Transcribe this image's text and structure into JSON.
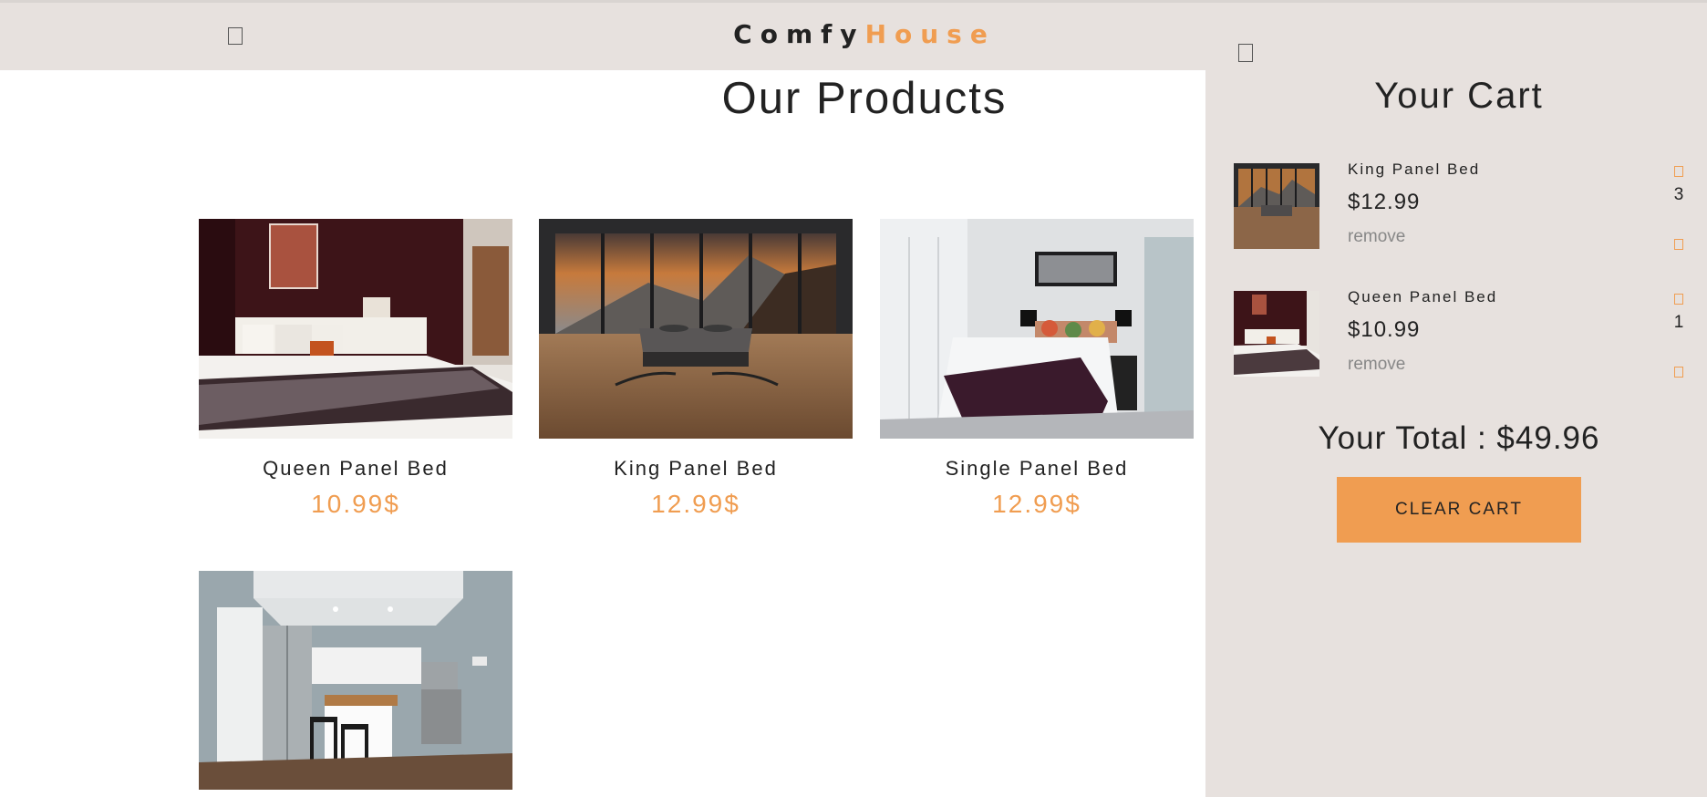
{
  "navbar": {
    "menu_icon": "menu-icon",
    "logo_part1": "Comfy",
    "logo_part2": "House",
    "accent_color": "#f09d51",
    "bar_color": "#e7e1de"
  },
  "products": {
    "title": "Our Products",
    "items": [
      {
        "name": "Queen Panel Bed",
        "price": "10.99$",
        "image": "bedroom-queen-bed-photo"
      },
      {
        "name": "King Panel Bed",
        "price": "12.99$",
        "image": "mountain-view-bed-photo"
      },
      {
        "name": "Single Panel Bed",
        "price": "12.99$",
        "image": "white-bedroom-bed-photo"
      },
      {
        "name": "",
        "price": "",
        "image": "kitchen-photo"
      }
    ]
  },
  "cart": {
    "close_icon": "close-cart-icon",
    "title": "Your Cart",
    "items": [
      {
        "name": "King Panel Bed",
        "price": "$12.99",
        "remove": "remove",
        "qty": "3",
        "image": "mountain-view-bed-thumb"
      },
      {
        "name": "Queen Panel Bed",
        "price": "$10.99",
        "remove": "remove",
        "qty": "1",
        "image": "bedroom-queen-bed-thumb"
      }
    ],
    "total": "Your Total : $49.96",
    "clear_label": "CLEAR CART"
  }
}
